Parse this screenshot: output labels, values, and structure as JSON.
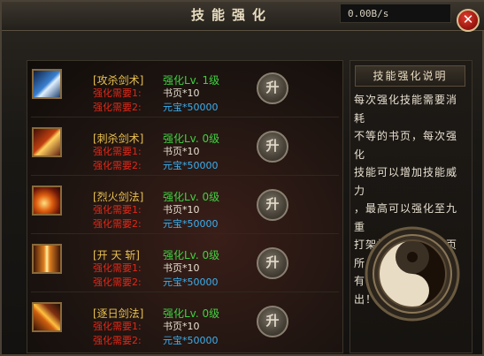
{
  "window": {
    "title": "技能强化",
    "speed": "0.00B/s"
  },
  "skills": [
    {
      "name": "[攻杀剑术]",
      "req1": "强化需要1:",
      "req2": "强化需要2:",
      "level": "强化Lv. 1级",
      "pages": "书页*10",
      "gold": "元宝*50000",
      "upgrade_label": "升"
    },
    {
      "name": "[刺杀剑术]",
      "req1": "强化需要1:",
      "req2": "强化需要2:",
      "level": "强化Lv. 0级",
      "pages": "书页*10",
      "gold": "元宝*50000",
      "upgrade_label": "升"
    },
    {
      "name": "[烈火剑法]",
      "req1": "强化需要1:",
      "req2": "强化需要2:",
      "level": "强化Lv. 0级",
      "pages": "书页*10",
      "gold": "元宝*50000",
      "upgrade_label": "升"
    },
    {
      "name": "[开 天 斩]",
      "req1": "强化需要1:",
      "req2": "强化需要2:",
      "level": "强化Lv. 0级",
      "pages": "书页*10",
      "gold": "元宝*50000",
      "upgrade_label": "升"
    },
    {
      "name": "[逐日剑法]",
      "req1": "强化需要1:",
      "req2": "强化需要2:",
      "level": "强化Lv. 0级",
      "pages": "书页*10",
      "gold": "元宝*50000",
      "upgrade_label": "升"
    }
  ],
  "info": {
    "title": "技能强化说明",
    "lines": [
      "每次强化技能需要消耗",
      "不等的书页，每次强化",
      "技能可以增加技能威力",
      "，最高可以强化至九重",
      "打架打怪必备，书页所",
      "有的怪物都可以爆出！"
    ]
  },
  "colors": {
    "skill_name": "#e8c050",
    "requirement": "#e02818",
    "level": "#40d040",
    "pages": "#e8e0d0",
    "gold": "#3ab0f0"
  },
  "icons": {
    "close": "close-icon",
    "skills": [
      "attack-slash-icon",
      "thrust-slash-icon",
      "blazing-fire-icon",
      "heaven-split-icon",
      "sun-chase-icon"
    ],
    "emblem": "taiji-icon"
  }
}
